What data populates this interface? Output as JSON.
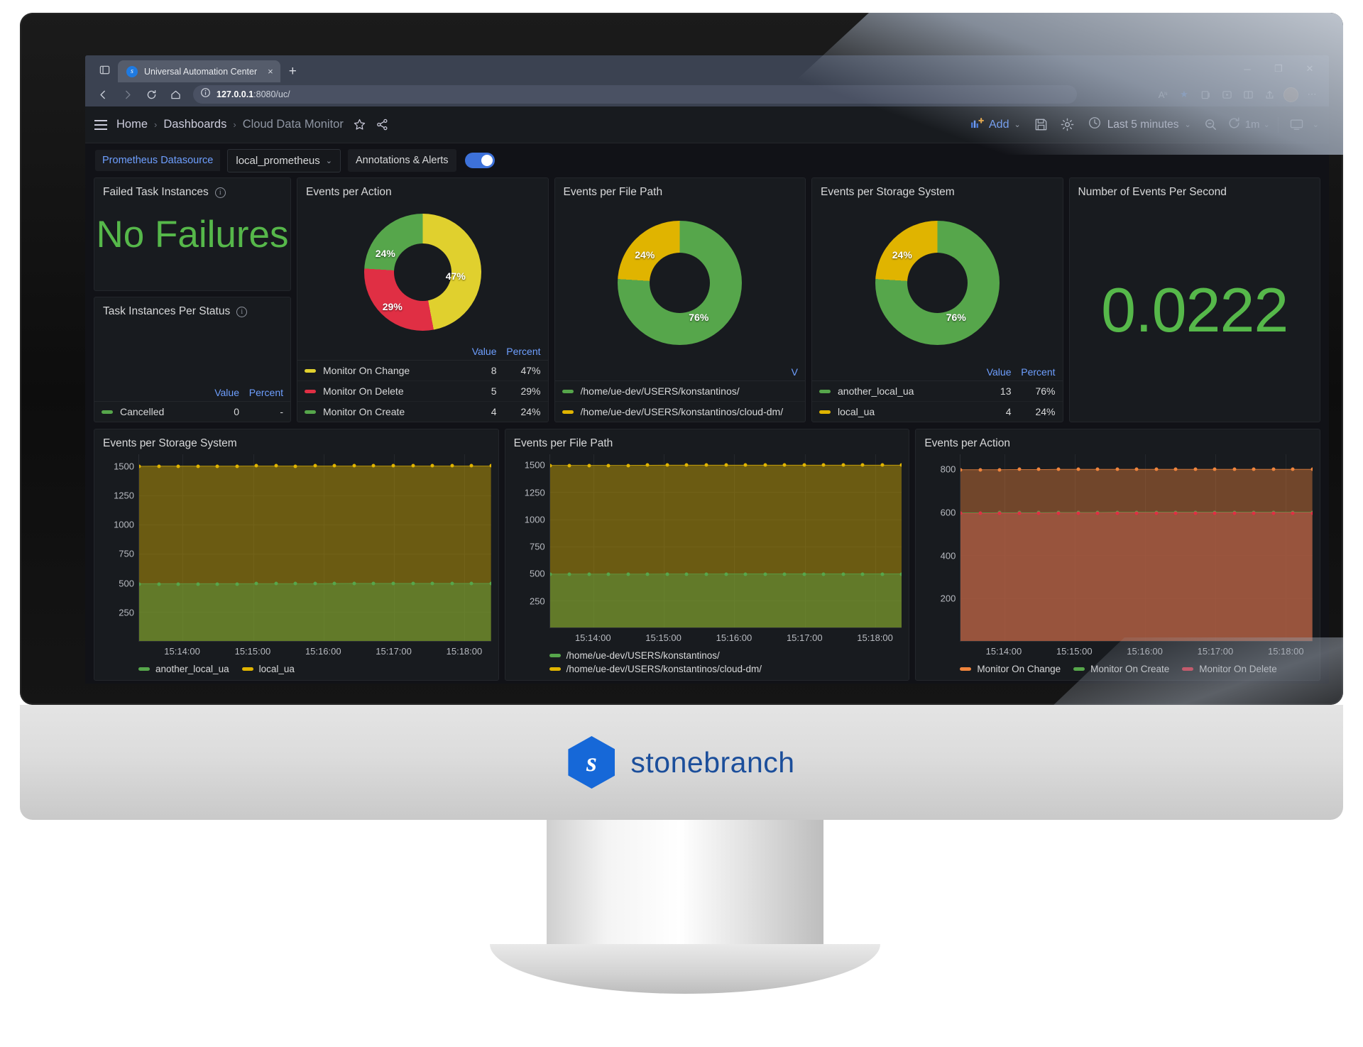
{
  "browser": {
    "tab_title": "Universal Automation Center",
    "tab_favicon": "s",
    "tab_close": "×",
    "new_tab": "+",
    "url_host": "127.0.0.1",
    "url_rest": ":8080/uc/",
    "win_minimize": "─",
    "win_maximize": "❐",
    "win_close": "✕",
    "icons": {
      "tab_list": "tab-list-icon",
      "back": "back-arrow-icon",
      "forward": "forward-arrow-icon",
      "reload": "reload-icon",
      "home": "home-icon",
      "info": "site-info-icon",
      "read_aloud": "read-aloud-icon",
      "favorite": "favorite-star-icon",
      "collections": "collections-icon",
      "browser_essentials": "browser-essentials-icon",
      "split_screen": "split-screen-icon",
      "share": "share-icon",
      "profile": "profile-avatar-icon",
      "settings_more": "more-options-icon"
    }
  },
  "grafana_nav": {
    "breadcrumb": [
      "Home",
      "Dashboards",
      "Cloud Data Monitor"
    ],
    "separator": "›",
    "star_icon": "star-outline-icon",
    "share_icon": "share-nodes-icon",
    "add_label": "Add",
    "add_chevron": "⌄",
    "save_icon": "save-dashboard-icon",
    "settings_icon": "dashboard-settings-icon",
    "clock_icon": "clock-icon",
    "time_range": "Last 5 minutes",
    "time_chevron": "⌄",
    "zoom_out_icon": "zoom-out-icon",
    "refresh_icon": "refresh-icon",
    "refresh_interval": "1m",
    "refresh_chevron": "⌄",
    "kiosk_icon": "tv-kiosk-icon",
    "panel_chevron": "⌄"
  },
  "variables": {
    "datasource_label": "Prometheus Datasource",
    "datasource_value": "local_prometheus",
    "datasource_chevron": "⌄",
    "annotations_label": "Annotations & Alerts",
    "annotations_enabled": true
  },
  "panels": {
    "failed_task_instances": {
      "title": "Failed Task Instances",
      "info_icon": "info-circle-icon",
      "value": "No Failures",
      "value_color": "#56b84a"
    },
    "task_instances_per_status": {
      "title": "Task Instances Per Status",
      "info_icon": "info-circle-icon",
      "columns": [
        "Value",
        "Percent"
      ],
      "rows": [
        {
          "name": "Cancelled",
          "value": "0",
          "percent": "-",
          "color": "#56a64b"
        }
      ]
    },
    "events_per_action_pie": {
      "title": "Events per Action",
      "columns": [
        "Value",
        "Percent"
      ],
      "rows": [
        {
          "name": "Monitor On Change",
          "value": "8",
          "percent": "47%",
          "color": "#e0d02e"
        },
        {
          "name": "Monitor On Delete",
          "value": "5",
          "percent": "29%",
          "color": "#e02f44"
        },
        {
          "name": "Monitor On Create",
          "value": "4",
          "percent": "24%",
          "color": "#56a64b"
        }
      ],
      "slice_labels": [
        "24%",
        "47%",
        "29%"
      ]
    },
    "events_per_file_path_pie": {
      "title": "Events per File Path",
      "columns_toggle": "V",
      "rows": [
        {
          "name": "/home/ue-dev/USERS/konstantinos/",
          "value": "",
          "percent": "76%",
          "color": "#56a64b"
        },
        {
          "name": "/home/ue-dev/USERS/konstantinos/cloud-dm/",
          "value": "",
          "percent": "24%",
          "color": "#e0b400"
        }
      ],
      "slice_labels": [
        "24%",
        "76%"
      ]
    },
    "events_per_storage_system_pie": {
      "title": "Events per Storage System",
      "columns": [
        "Value",
        "Percent"
      ],
      "rows": [
        {
          "name": "another_local_ua",
          "value": "13",
          "percent": "76%",
          "color": "#56a64b"
        },
        {
          "name": "local_ua",
          "value": "4",
          "percent": "24%",
          "color": "#e0b400"
        }
      ],
      "slice_labels": [
        "24%",
        "76%"
      ]
    },
    "events_per_second": {
      "title": "Number of Events Per Second",
      "value": "0.0222",
      "value_color": "#56b84a"
    }
  },
  "chart_data": [
    {
      "id": "storage_ts",
      "type": "area",
      "title": "Events per Storage System",
      "xlabel": "",
      "ylabel": "",
      "ylim": [
        0,
        1600
      ],
      "yticks": [
        250,
        500,
        750,
        1000,
        1250,
        1500
      ],
      "xticks": [
        "15:14:00",
        "15:15:00",
        "15:16:00",
        "15:17:00",
        "15:18:00"
      ],
      "grid": true,
      "legend_position": "bottom",
      "series": [
        {
          "name": "local_ua",
          "color": "#e0b400",
          "value": 1500,
          "values": [
            1497,
            1498,
            1498,
            1498,
            1498,
            1498,
            1500,
            1500,
            1499,
            1500,
            1500,
            1500,
            1500,
            1500,
            1500,
            1500,
            1500,
            1500,
            1500
          ]
        },
        {
          "name": "another_local_ua",
          "color": "#56a64b",
          "value": 490,
          "values": [
            489,
            489,
            489,
            489,
            489,
            489,
            490,
            490,
            490,
            490,
            492,
            493,
            493,
            493,
            493,
            493,
            493,
            493,
            493
          ]
        }
      ]
    },
    {
      "id": "filepath_ts",
      "type": "area",
      "title": "Events per File Path",
      "xlabel": "",
      "ylabel": "",
      "ylim": [
        0,
        1600
      ],
      "yticks": [
        250,
        500,
        750,
        1000,
        1250,
        1500
      ],
      "xticks": [
        "15:14:00",
        "15:15:00",
        "15:16:00",
        "15:17:00",
        "15:18:00"
      ],
      "grid": true,
      "legend_position": "bottom",
      "series": [
        {
          "name": "/home/ue-dev/USERS/konstantinos/cloud-dm/",
          "color": "#e0b400",
          "value": 1500,
          "values": [
            1497,
            1498,
            1498,
            1498,
            1498,
            1499,
            1500,
            1500,
            1500,
            1500,
            1500,
            1500,
            1500,
            1500,
            1500,
            1500,
            1500,
            1500,
            1500
          ]
        },
        {
          "name": "/home/ue-dev/USERS/konstantinos/",
          "color": "#56a64b",
          "value": 495,
          "values": [
            493,
            493,
            493,
            493,
            493,
            493,
            494,
            494,
            494,
            495,
            495,
            495,
            495,
            495,
            495,
            495,
            495,
            495,
            495
          ]
        }
      ]
    },
    {
      "id": "action_ts",
      "type": "area",
      "title": "Events per Action",
      "xlabel": "",
      "ylabel": "",
      "ylim": [
        0,
        870
      ],
      "yticks": [
        200,
        400,
        600,
        800
      ],
      "xticks": [
        "15:14:00",
        "15:15:00",
        "15:16:00",
        "15:17:00",
        "15:18:00"
      ],
      "grid": true,
      "legend_position": "bottom",
      "series": [
        {
          "name": "Monitor On Change",
          "color": "#ef843c",
          "value": 800,
          "values": [
            798,
            798,
            798,
            799,
            799,
            800,
            800,
            800,
            800,
            800,
            800,
            800,
            800,
            800,
            800,
            800,
            800,
            800,
            800
          ]
        },
        {
          "name": "Monitor On Create",
          "color": "#56a64b",
          "value": 600,
          "values": [
            597,
            597,
            598,
            598,
            598,
            599,
            599,
            599,
            600,
            600,
            600,
            600,
            600,
            600,
            600,
            600,
            600,
            600,
            600
          ]
        },
        {
          "name": "Monitor On Delete",
          "color": "#e02f44",
          "value": 596,
          "values": [
            594,
            594,
            595,
            595,
            595,
            596,
            596,
            596,
            597,
            597,
            597,
            597,
            597,
            597,
            597,
            597,
            597,
            597,
            597
          ]
        }
      ]
    }
  ],
  "brand": {
    "name": "stonebranch",
    "mark": "s"
  }
}
